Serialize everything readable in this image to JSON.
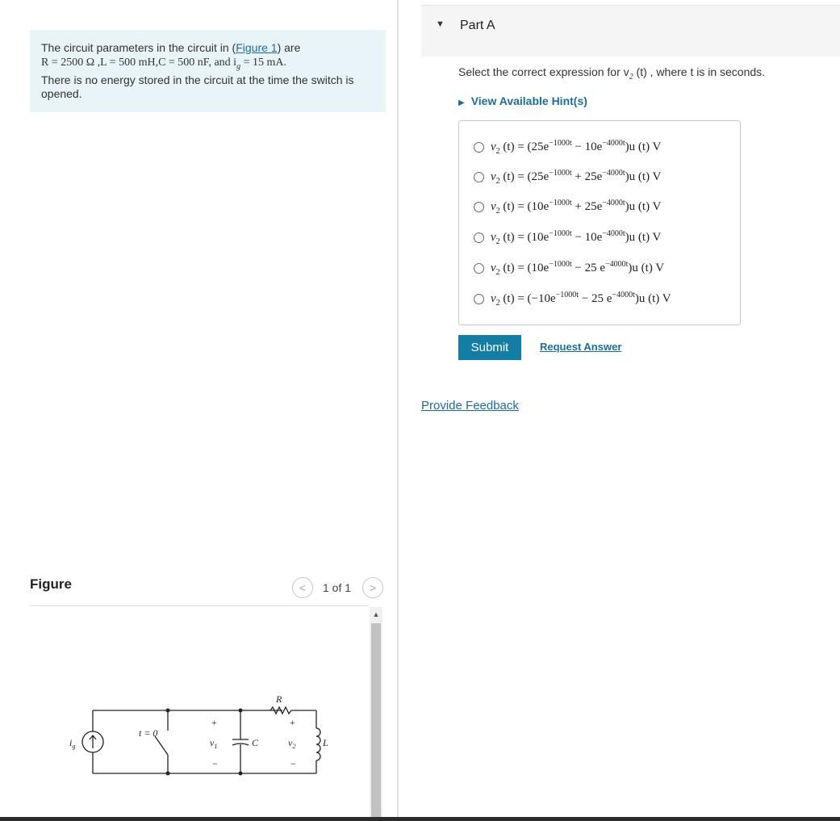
{
  "problem": {
    "line1_pre": "The circuit parameters in the circuit in (",
    "figure_link": "Figure 1",
    "line1_post": ") are",
    "params": "R = 2500  Ω ,L = 500 mH,C = 500 nF, and i",
    "params_sub": "g",
    "params_tail": " = 15 mA.",
    "line3": "There is no energy stored in the circuit at the time the switch is opened."
  },
  "figure": {
    "title": "Figure",
    "page_indicator": "1 of 1",
    "prev_icon": "chevron-left-icon",
    "next_icon": "chevron-right-icon",
    "labels": {
      "source": "i",
      "source_sub": "g",
      "switch": "t = 0",
      "v1": "v",
      "v1_sub": "1",
      "C": "C",
      "R": "R",
      "v2": "v",
      "v2_sub": "2",
      "L": "L",
      "plus": "+",
      "minus": "−"
    }
  },
  "part": {
    "caret": "▼",
    "title": "Part A",
    "question_pre": "Select the correct expression for v",
    "question_sub": "2",
    "question_mid": " (t) , where t is in seconds.",
    "hint": "View Available Hint(s)",
    "options": [
      {
        "c1": "(25e",
        "e1": "−1000t",
        "op": " − 10e",
        "e2": "−4000t",
        "tail": ")u (t) V"
      },
      {
        "c1": "(25e",
        "e1": "−1000t",
        "op": " + 25e",
        "e2": "−4000t",
        "tail": ")u (t) V"
      },
      {
        "c1": "(10e",
        "e1": "−1000t",
        "op": " + 25e",
        "e2": "−4000t",
        "tail": ")u (t) V"
      },
      {
        "c1": "(10e",
        "e1": "−1000t",
        "op": " − 10e",
        "e2": "−4000t",
        "tail": ")u (t) V"
      },
      {
        "c1": "(10e",
        "e1": "−1000t",
        "op": " − 25 e",
        "e2": "−4000t",
        "tail": ")u (t) V"
      },
      {
        "c1": "(−10e",
        "e1": "−1000t",
        "op": " − 25 e",
        "e2": "−4000t",
        "tail": ")u (t) V"
      }
    ],
    "option_lhs": "v",
    "option_lhs_sub": "2",
    "option_lhs_tail": " (t) = ",
    "submit": "Submit",
    "request_answer": "Request Answer"
  },
  "feedback": "Provide Feedback"
}
